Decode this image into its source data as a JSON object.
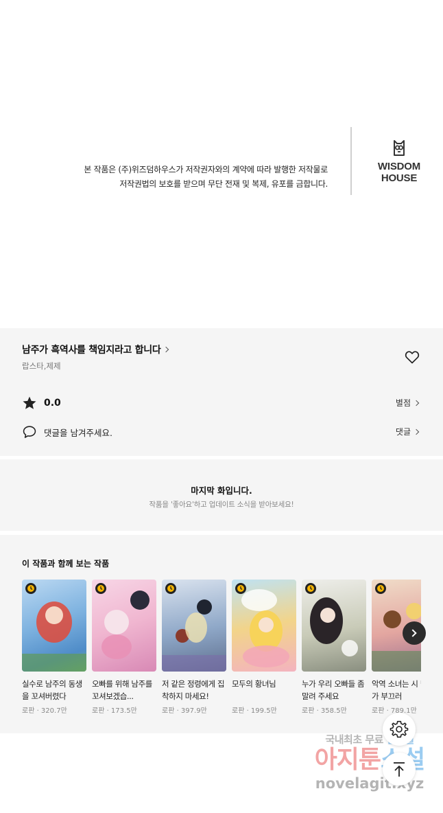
{
  "copyright": {
    "line1": "본 작품은 (주)위즈덤하우스가 저작권자와의 계약에 따라 발행한 저작물로",
    "line2": "저작권법의 보호를 받으며 무단 전재 및 복제, 유포를 금합니다.",
    "logo_line1": "WISDOM",
    "logo_line2": "HOUSE"
  },
  "work": {
    "title": "남주가 흑역사를 책임지라고 합니다",
    "authors": "랍스타,제제",
    "rating": "0.0",
    "rating_link": "별점",
    "comment_placeholder": "댓글을 남겨주세요.",
    "comment_link": "댓글"
  },
  "last_episode": {
    "title": "마지막 화입니다.",
    "subtitle": "작품을 '좋아요'하고 업데이트 소식을 받아보세요!"
  },
  "recommendations": {
    "title": "이 작품과 함께 보는 작품",
    "items": [
      {
        "title": "실수로 남주의 동생을 꼬셔버렸다",
        "meta": "로판 · 320.7만",
        "color": "#7fb3e0"
      },
      {
        "title": "오빠를 위해 남주를 꼬셔보겠습...",
        "meta": "로판 · 173.5만",
        "color": "#f0b6d0"
      },
      {
        "title": "저 같은 정령에게 집착하지 마세요!",
        "meta": "로판 · 397.9만",
        "color": "#8fa8c8"
      },
      {
        "title": "모두의 황녀님",
        "meta": "로판 · 199.5만",
        "color": "#f2d48a"
      },
      {
        "title": "누가 우리 오빠들 좀 말려 주세요",
        "meta": "로판 · 358.5만",
        "color": "#c9cbb8"
      },
      {
        "title": "악역 소녀는 시 받기가 부끄러",
        "meta": "로판 · 789.1만",
        "color": "#e3a6a0"
      }
    ]
  },
  "watermark": {
    "line1a": "국내최초 무료 ",
    "line1b": "웹소설",
    "line2a": "아지툰",
    "line2b": "소설",
    "line3": "novelagit.xyz"
  },
  "icons": {
    "heart": "heart-outline-icon",
    "star": "star-icon",
    "comment": "speech-bubble-icon",
    "clock": "clock-icon",
    "next": "chevron-right-icon",
    "gear": "gear-icon",
    "top": "arrow-up-icon"
  }
}
